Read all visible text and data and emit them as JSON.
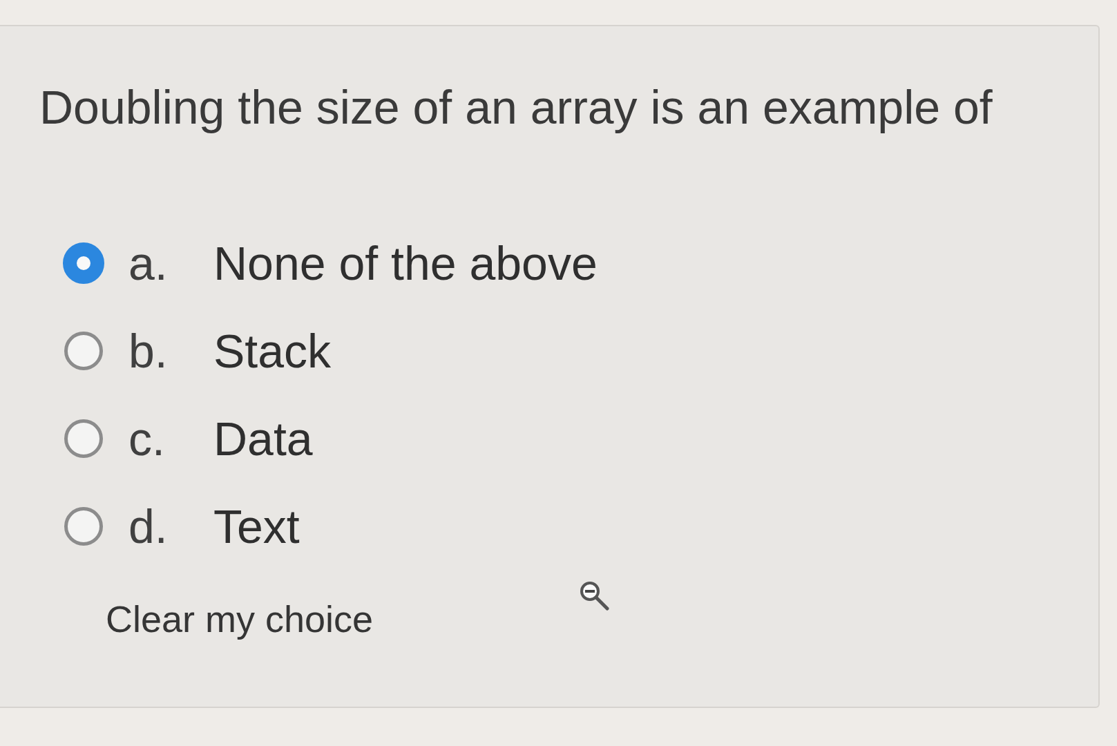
{
  "question": {
    "text": "Doubling the size of an array is an example of"
  },
  "options": [
    {
      "letter": "a.",
      "label": "None of the above",
      "selected": true
    },
    {
      "letter": "b.",
      "label": "Stack",
      "selected": false
    },
    {
      "letter": "c.",
      "label": "Data",
      "selected": false
    },
    {
      "letter": "d.",
      "label": "Text",
      "selected": false
    }
  ],
  "clear_link": "Clear my choice"
}
